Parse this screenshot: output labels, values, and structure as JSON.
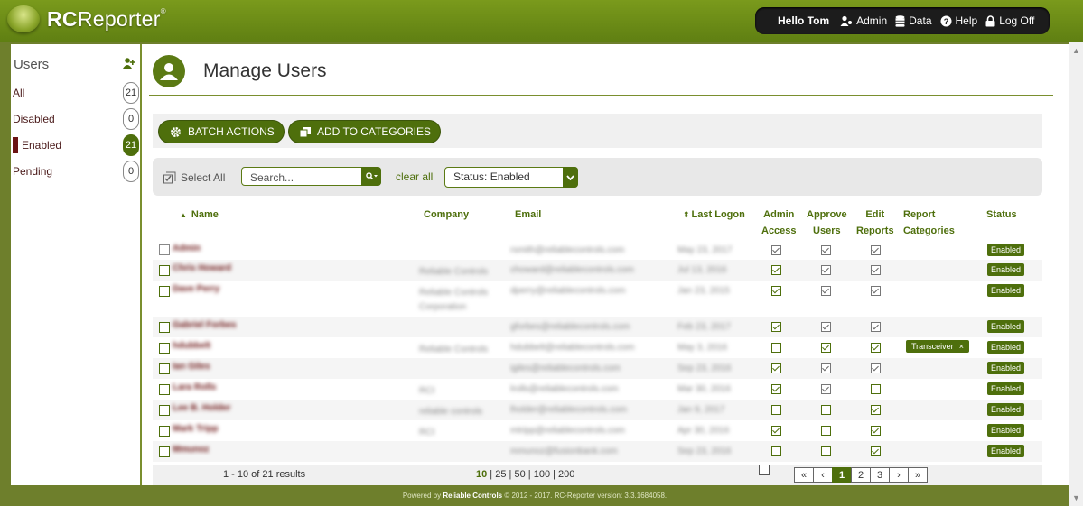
{
  "app": {
    "logo_bold": "RC",
    "logo_light": "Reporter",
    "trademark": "®"
  },
  "usermenu": {
    "hello": "Hello Tom",
    "items": [
      {
        "label": "Admin",
        "icon": "admin-users-icon"
      },
      {
        "label": "Data",
        "icon": "database-icon"
      },
      {
        "label": "Help",
        "icon": "help-icon"
      },
      {
        "label": "Log Off",
        "icon": "lock-icon"
      }
    ]
  },
  "sidebar": {
    "title": "Users",
    "items": [
      {
        "label": "All",
        "count": "21"
      },
      {
        "label": "Disabled",
        "count": "0"
      },
      {
        "label": "Enabled",
        "count": "21",
        "active": true
      },
      {
        "label": "Pending",
        "count": "0"
      }
    ]
  },
  "page": {
    "title": "Manage Users"
  },
  "actions": {
    "batch_label": "BATCH ACTIONS",
    "categories_label": "ADD TO CATEGORIES"
  },
  "filter": {
    "select_all": "Select All",
    "search_placeholder": "Search...",
    "clear_all": "clear all",
    "status_value": "Status: Enabled"
  },
  "table": {
    "headers": {
      "name": "Name",
      "company": "Company",
      "email": "Email",
      "last_logon": "Last Logon",
      "admin_access": [
        "Admin",
        "Access"
      ],
      "approve_users": [
        "Approve",
        "Users"
      ],
      "edit_reports": [
        "Edit",
        "Reports"
      ],
      "report_categories": [
        "Report",
        "Categories"
      ],
      "status": "Status"
    },
    "rows": [
      {
        "name": "Admin",
        "company": "",
        "email": "rsmith@reliablecontrols.com",
        "last_logon": "May 23, 2017",
        "admin": true,
        "approve": true,
        "edit": true,
        "admin_grey": true,
        "category": "",
        "status": "Enabled"
      },
      {
        "name": "Chris Howard",
        "company": "Reliable Controls",
        "email": "choward@reliablecontrols.com",
        "last_logon": "Jul 13, 2016",
        "admin": true,
        "approve": true,
        "edit": true,
        "admin_grey": false,
        "category": "",
        "status": "Enabled"
      },
      {
        "name": "Dave Perry",
        "company": "Reliable Controls Corporation",
        "email": "dperry@reliablecontrols.com",
        "last_logon": "Jan 23, 2015",
        "admin": true,
        "approve": true,
        "edit": true,
        "admin_grey": false,
        "category": "",
        "status": "Enabled"
      },
      {
        "name": "Gabriel Forbes",
        "company": "",
        "email": "gforbes@reliablecontrols.com",
        "last_logon": "Feb 23, 2017",
        "admin": true,
        "approve": true,
        "edit": true,
        "admin_grey": false,
        "category": "",
        "status": "Enabled"
      },
      {
        "name": "hdubbelt",
        "company": "Reliable Controls",
        "email": "hdubbelt@reliablecontrols.com",
        "last_logon": "May 3, 2016",
        "admin": false,
        "approve": true,
        "edit": true,
        "admin_grey": false,
        "category": "Transceiver",
        "status": "Enabled"
      },
      {
        "name": "Ian Giles",
        "company": "",
        "email": "igiles@reliablecontrols.com",
        "last_logon": "Sep 23, 2016",
        "admin": true,
        "approve": true,
        "edit": true,
        "admin_grey": false,
        "category": "",
        "status": "Enabled"
      },
      {
        "name": "Lara Rolls",
        "company": "RCI",
        "email": "lrolls@reliablecontrols.com",
        "last_logon": "Mar 30, 2016",
        "admin": true,
        "approve": true,
        "edit": false,
        "admin_grey": false,
        "category": "",
        "status": "Enabled"
      },
      {
        "name": "Lee B. Holder",
        "company": "reliable controls",
        "email": "lholder@reliablecontrols.com",
        "last_logon": "Jan 9, 2017",
        "admin": false,
        "approve": false,
        "edit": true,
        "admin_grey": false,
        "category": "",
        "status": "Enabled"
      },
      {
        "name": "Mark Tripp",
        "company": "RCI",
        "email": "mtripp@reliablecontrols.com",
        "last_logon": "Apr 30, 2016",
        "admin": true,
        "approve": false,
        "edit": true,
        "admin_grey": false,
        "category": "",
        "status": "Enabled"
      },
      {
        "name": "Mmunoz",
        "company": "",
        "email": "mmunoz@fusionbank.com",
        "last_logon": "Sep 23, 2016",
        "admin": false,
        "approve": false,
        "edit": true,
        "admin_grey": false,
        "category": "",
        "status": "Enabled"
      }
    ]
  },
  "footer": {
    "results": "1 - 10 of 21 results",
    "page_sizes": [
      "10",
      "25",
      "50",
      "100",
      "200"
    ],
    "current_size": "10",
    "pager": [
      "«",
      "‹",
      "1",
      "2",
      "3",
      "›",
      "»"
    ],
    "current_page": "1"
  },
  "copyright": {
    "prefix": "Powered by",
    "brand": "Reliable Controls",
    "suffix": "© 2012 - 2017. RC-Reporter version: 3.3.1684058."
  },
  "colors": {
    "accent": "#4e6f0c",
    "header_bg": "#6e8c1a",
    "marker": "#6b1414"
  }
}
